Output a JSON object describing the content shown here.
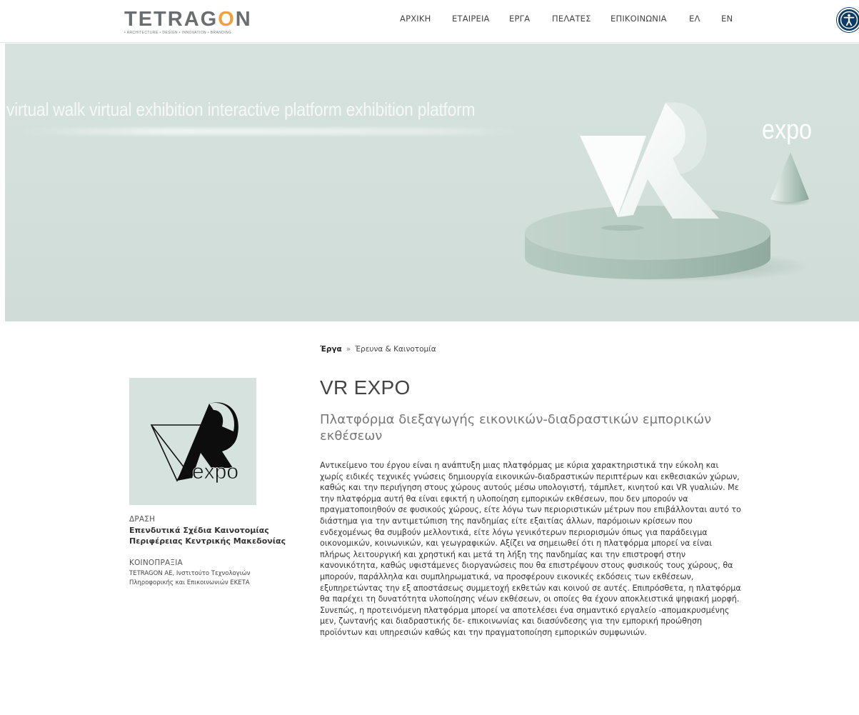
{
  "header": {
    "logo": {
      "word_part1": "TETRAG",
      "word_o": "O",
      "word_part2": "N",
      "tagline": "• ARCHITECTURE • DESIGN • INNOVATION • BRANDING"
    },
    "nav": [
      {
        "label": "ΑΡΧΙΚΗ"
      },
      {
        "label": "ΕΤΑΙΡΕΙΑ"
      },
      {
        "label": "ΕΡΓΑ"
      },
      {
        "label": "ΠΕΛΑΤΕΣ"
      },
      {
        "label": "ΕΠΙΚΟΙΝΩΝΙΑ"
      },
      {
        "label": "ΕΛ"
      },
      {
        "label": "EN"
      }
    ],
    "accessibility_icon": "accessibility-icon"
  },
  "hero": {
    "text": "virtual walk virtual exhibition interactive platform exhibition platform",
    "expo_label": "expo",
    "background": "#d3e0db"
  },
  "sidebar": {
    "logo_text": "expo",
    "action_label": "ΔΡΑΣΗ",
    "action_value_line1": "Επενδυτικά Σχέδια Καινοτομίας",
    "action_value_line2": "Περιφέρειας Κεντρικής Μακεδονίας",
    "consortium_label": "ΚΟΙΝΟΠΡΑΞΙΑ",
    "consortium_value_line1": "TETRAGON AE, Ινστιτούτο Τεχνολογιών",
    "consortium_value_line2": "Πληροφορικής και Επικοινωνιών ΕΚΕΤΑ"
  },
  "main": {
    "breadcrumb": {
      "link": "Έργα",
      "separator": "»",
      "current": "Έρευνα & Καινοτομία"
    },
    "title": "VR EXPO",
    "subtitle": "Πλατφόρμα διεξαγωγής εικονικών-διαδραστικών εμπορικών εκθέσεων",
    "body": "Αντικείμενο του έργου είναι η ανάπτυξη μιας πλατφόρμας με κύρια χαρακτηριστικά την εύκολη και χωρίς ειδικές τεχνικές γνώσεις δημιουργία εικονικών-διαδραστικών περιπτέρων και εκθεσιακών χώρων, καθώς και την περιήγηση στους χώρους αυτούς μέσω υπολογιστή, τάμπλετ, κινητού και VR γυαλιών. Με την πλατφόρμα αυτή θα είναι εφικτή η υλοποίηση εμπορικών εκθέσεων, που δεν μπορούν να πραγματοποιηθούν σε φυσικούς χώρους, είτε λόγω των περιοριστικών μέτρων που επιβάλλονται αυτό το διάστημα για την αντιμετώπιση της πανδημίας είτε εξαιτίας άλλων, παρόμοιων κρίσεων που ενδεχομένως θα συμβούν μελλοντικά, είτε λόγω γενικότερων περιορισμών όπως για παράδειγμα οικονομικών, κοινωνικών, και γεωγραφικών. Αξίζει να σημειωθεί ότι η πλατφόρμα μπορεί να είναι πλήρως λειτουργική και χρηστική και μετά τη λήξη της πανδημίας και την επιστροφή στην κανονικότητα, καθώς υφιστάμενες διοργανώσεις που θα επιστρέψουν στους φυσικούς τους χώρους, θα μπορούν, παράλληλα και συμπληρωματικά, να προσφέρουν εικονικές εκδόσεις των εκθέσεων, εξυπηρετώντας την εξ αποστάσεως συμμετοχή εκθετών και κοινού σε αυτές. Επιπρόσθετα, η πλατφόρμα θα παρέχει τη δυνατότητα υλοποίησης νέων εκθέσεων, οι οποίες θα έχουν αποκλειστικά ψηφιακή μορφή. Συνεπώς, η προτεινόμενη πλατφόρμα μπορεί να αποτελέσει ένα σημαντικό εργαλείο -απομακρυσμένης μεν, ζωντανής και διαδραστικής δε- επικοινωνίας και διασύνδεσης για την εμπορική προώθηση προϊόντων και υπηρεσιών καθώς και την πραγματοποίηση εμπορικών συμφωνιών."
  },
  "colors": {
    "accent_orange": "#f0a23a",
    "logo_grey": "#6b6e70",
    "hero_bg": "#d3e0db",
    "accessibility_blue": "#0d3b66"
  }
}
